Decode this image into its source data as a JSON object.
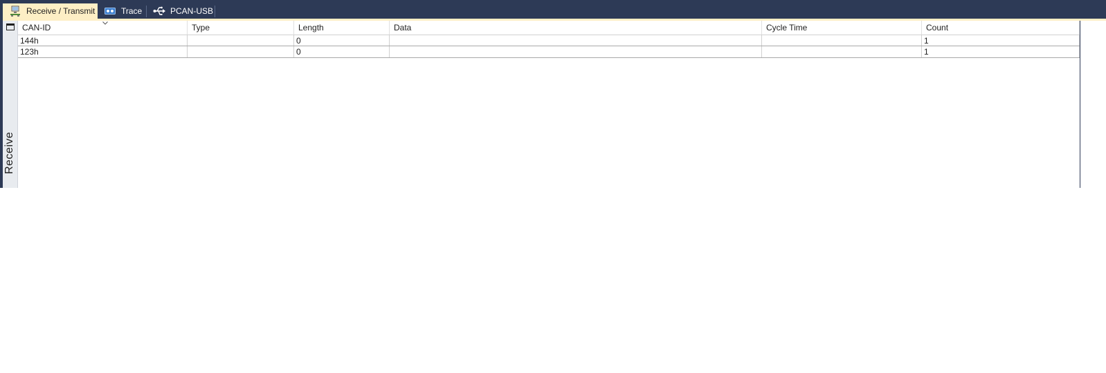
{
  "tabs": [
    {
      "label": "Receive / Transmit",
      "icon": "network-computer-icon",
      "active": true
    },
    {
      "label": "Trace",
      "icon": "trace-tape-icon",
      "active": false
    },
    {
      "label": "PCAN-USB",
      "icon": "usb-icon",
      "active": false
    }
  ],
  "side_panel": {
    "label": "Receive",
    "icon": "window-icon"
  },
  "grid": {
    "columns": [
      "CAN-ID",
      "Type",
      "Length",
      "Data",
      "Cycle Time",
      "Count"
    ],
    "sort_column": "CAN-ID",
    "rows": [
      {
        "can_id": "144h",
        "type": "",
        "length": "0",
        "data": "",
        "cycle_time": "",
        "count": "1"
      },
      {
        "can_id": "123h",
        "type": "",
        "length": "0",
        "data": "",
        "cycle_time": "",
        "count": "1"
      }
    ]
  },
  "colors": {
    "titlebar": "#2d3a56",
    "active_tab": "#fdefc5"
  }
}
